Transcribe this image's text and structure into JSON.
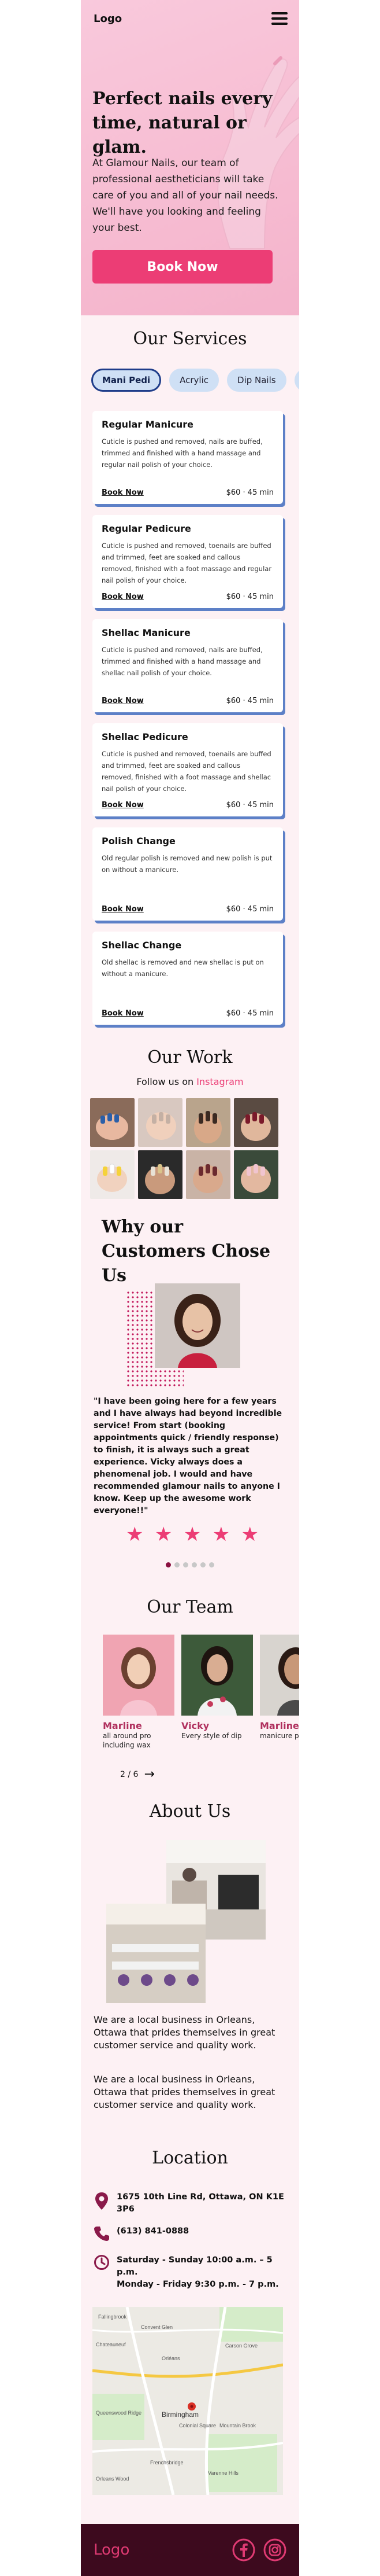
{
  "nav": {
    "logo": "Logo",
    "menu_icon": "hamburger-icon"
  },
  "hero": {
    "title": "Perfect nails every time, natural or glam.",
    "subtitle": "At Glamour Nails, our team of professional aestheticians will take care of you and all of your nail needs. We'll have you looking and feeling your best.",
    "cta": "Book Now"
  },
  "services": {
    "title": "Our Services",
    "tabs": [
      "Mani Pedi",
      "Acrylic",
      "Dip Nails",
      "A"
    ],
    "active_tab": "Mani Pedi",
    "cards": [
      {
        "name": "Regular Manicure",
        "desc": "Cuticle is pushed and removed, nails are buffed, trimmed and finished with a hand massage and regular nail polish of your choice.",
        "book": "Book Now",
        "price": "$60 · 45 min"
      },
      {
        "name": "Regular Pedicure",
        "desc": "Cuticle is pushed and removed, toenails are buffed and trimmed, feet are soaked and callous removed, finished with a foot massage and regular nail polish of your choice.",
        "book": "Book Now",
        "price": "$60 · 45 min"
      },
      {
        "name": "Shellac Manicure",
        "desc": "Cuticle is pushed and removed, nails are buffed, trimmed and finished with a hand massage and shellac nail polish of your choice.",
        "book": "Book Now",
        "price": "$60 · 45 min"
      },
      {
        "name": "Shellac Pedicure",
        "desc": "Cuticle is pushed and removed, toenails are buffed and trimmed, feet are soaked and callous removed, finished with a foot massage and shellac nail polish of your choice.",
        "book": "Book Now",
        "price": "$60 · 45 min"
      },
      {
        "name": "Polish Change",
        "desc": "Old regular polish is removed and new polish is put on without a manicure.",
        "book": "Book Now",
        "price": "$60 · 45 min"
      },
      {
        "name": "Shellac Change",
        "desc": "Old shellac is removed and new shellac is put on without a manicure.",
        "book": "Book Now",
        "price": "$60 · 45 min"
      }
    ]
  },
  "work": {
    "title": "Our Work",
    "follow_prefix": "Follow us on ",
    "follow_link": "Instagram"
  },
  "testimonials": {
    "title": "Why our Customers Chose Us",
    "quote": "\"I have been going here for a few years and I have always had beyond incredible service! From start (booking appointments quick / friendly response) to finish, it is always such a great experience. Vicky always does a phenomenal job. I would and have recommended glamour nails to anyone I know. Keep up the awesome work everyone!!\"",
    "rating": 5,
    "slides": 6,
    "current_slide": 1
  },
  "team": {
    "title": "Our Team",
    "members": [
      {
        "name": "Marline",
        "role": "all around pro including wax"
      },
      {
        "name": "Vicky",
        "role": "Every style of dip"
      },
      {
        "name": "Marline",
        "role": "manicure pedicure"
      }
    ],
    "pager": "2 / 6"
  },
  "about": {
    "title": "About Us",
    "para1": "We are a local business in Orleans, Ottawa that prides themselves in great customer service and quality work.",
    "para2": "We are a local business in Orleans, Ottawa that prides themselves in great customer service and quality work."
  },
  "location": {
    "title": "Location",
    "address": "1675 10th Line Rd, Ottawa, ON K1E 3P6",
    "phone": "(613) 841-0888",
    "hours1": "Saturday - Sunday 10:00 a.m. – 5 p.m.",
    "hours2": "Monday - Friday 9:30 p.m. - 7 p.m.",
    "map_labels": [
      "Fallingbrook",
      "Convent Glen",
      "Chateauneuf",
      "Carson Grove",
      "Orléans",
      "Birmingham",
      "Colonial Square",
      "Queenswood Ridge",
      "Mountain Brook",
      "Frenchsbridge",
      "Varenne Hills",
      "Orleans Wood"
    ]
  },
  "footer": {
    "logo": "Logo",
    "icons": [
      "facebook-icon",
      "instagram-icon"
    ]
  },
  "colors": {
    "accent": "#ec3d75",
    "footer_bg": "#3d0a1e",
    "card_shadow": "#5d80c7",
    "pill_bg": "#cfe0f5"
  }
}
